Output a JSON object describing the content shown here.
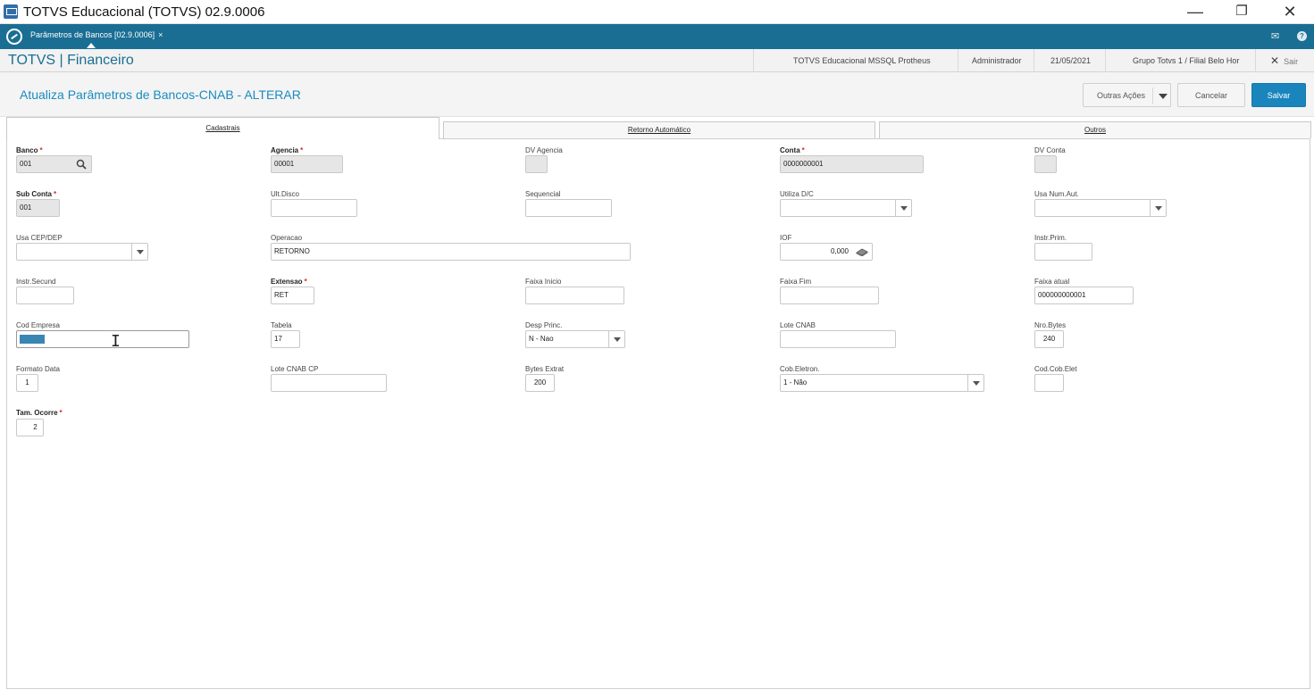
{
  "window": {
    "title": "TOTVS Educacional (TOTVS) 02.9.0006",
    "controls": {
      "minimize": "—",
      "restore": "❐",
      "close": "✕"
    }
  },
  "tabstrip": {
    "program_tab": "Parâmetros de Bancos [02.9.0006]",
    "close": "×",
    "mail_icon": "✉",
    "help_icon": "?"
  },
  "modulebar": {
    "title": "TOTVS | Financeiro",
    "environment": "TOTVS Educacional MSSQL Protheus",
    "user": "Administrador",
    "date": "21/05/2021",
    "branch": "Grupo Totvs 1 / Filial Belo Hor",
    "exit_label": "Sair",
    "exit_icon": "✕"
  },
  "header": {
    "title": "Atualiza Parâmetros de Bancos-CNAB - ALTERAR",
    "actions": {
      "more": "Outras Ações",
      "cancel": "Cancelar",
      "save": "Salvar"
    }
  },
  "tabs": [
    {
      "label": "Cadastrais",
      "active": true
    },
    {
      "label": "Retorno Automático",
      "active": false
    },
    {
      "label": "Outros",
      "active": false
    }
  ],
  "fields": {
    "banco": {
      "label": "Banco",
      "value": "001"
    },
    "agencia": {
      "label": "Agencia",
      "value": "00001"
    },
    "dv_agencia": {
      "label": "DV Agencia",
      "value": ""
    },
    "conta": {
      "label": "Conta",
      "value": "0000000001"
    },
    "dv_conta": {
      "label": "DV Conta",
      "value": ""
    },
    "sub_conta": {
      "label": "Sub Conta",
      "value": "001"
    },
    "ult_disco": {
      "label": "Ult.Disco",
      "value": ""
    },
    "sequencial": {
      "label": "Sequencial",
      "value": ""
    },
    "utiliza_dc": {
      "label": "Utiliza D/C",
      "value": ""
    },
    "usa_num_aut": {
      "label": "Usa Num.Aut.",
      "value": ""
    },
    "usa_cep_dep": {
      "label": "Usa CEP/DEP",
      "value": ""
    },
    "operacao": {
      "label": "Operacao",
      "value": "RETORNO"
    },
    "iof": {
      "label": "IOF",
      "value": "0,000"
    },
    "instr_prim": {
      "label": "Instr.Prim.",
      "value": ""
    },
    "instr_secund": {
      "label": "Instr.Secund",
      "value": ""
    },
    "extensao": {
      "label": "Extensao",
      "value": "RET"
    },
    "faixa_inicio": {
      "label": "Faixa Inicio",
      "value": ""
    },
    "faixa_fim": {
      "label": "Faixa Fim",
      "value": ""
    },
    "faixa_atual": {
      "label": "Faixa atual",
      "value": "000000000001"
    },
    "cod_empresa": {
      "label": "Cod Empresa",
      "value": ""
    },
    "tabela": {
      "label": "Tabela",
      "value": "17"
    },
    "desp_princ": {
      "label": "Desp Princ.",
      "value": "N - Nao"
    },
    "lote_cnab": {
      "label": "Lote CNAB",
      "value": ""
    },
    "nro_bytes": {
      "label": "Nro.Bytes",
      "value": "240"
    },
    "formato_data": {
      "label": "Formato Data",
      "value": "1"
    },
    "lote_cnab_cp": {
      "label": "Lote CNAB CP",
      "value": ""
    },
    "bytes_extrat": {
      "label": "Bytes Extrat",
      "value": "200"
    },
    "cob_eletron": {
      "label": "Cob.Eletron.",
      "value": "1 - Não"
    },
    "cod_cob_elet": {
      "label": "Cod.Cob.Elet",
      "value": ""
    },
    "tam_ocorre": {
      "label": "Tam. Ocorre",
      "value": "2"
    }
  },
  "colors": {
    "brand_blue": "#1a6e93",
    "title_blue": "#1a8cc0",
    "save_button": "#1a85bd",
    "required_star": "#d12b2b"
  }
}
